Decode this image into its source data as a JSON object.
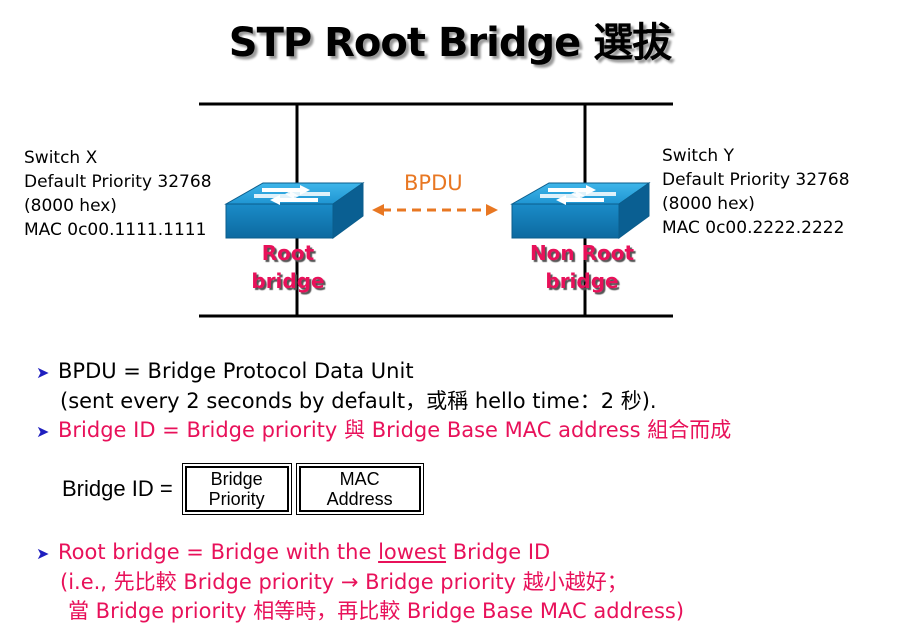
{
  "title": "STP Root Bridge 選拔",
  "switch_x": {
    "name": "Switch X",
    "priority": "Default Priority 32768",
    "hex": "(8000 hex)",
    "mac": "MAC 0c00.1111.1111",
    "role_line1": "Root",
    "role_line2": "bridge"
  },
  "switch_y": {
    "name": "Switch Y",
    "priority": "Default Priority 32768",
    "hex": "(8000 hex)",
    "mac": "MAC 0c00.2222.2222",
    "role_line1": "Non Root",
    "role_line2": "bridge"
  },
  "bpdu_label": "BPDU",
  "bullets": {
    "b1_line1": "BPDU = Bridge Protocol Data Unit",
    "b1_line2": "(sent every 2 seconds by default，或稱 hello time：2 秒).",
    "b2_line1": "Bridge ID = Bridge priority 與 Bridge Base MAC address 組合而成",
    "b3_line1": "Root bridge = Bridge with the ",
    "b3_line1_u": "lowest",
    "b3_line1_end": " Bridge ID",
    "b3_line2": "(i.e., 先比較 Bridge priority → Bridge priority 越小越好；",
    "b3_line3": "當 Bridge priority 相等時，再比較 Bridge Base MAC address)"
  },
  "formula": {
    "label": "Bridge ID =",
    "box1_l1": "Bridge",
    "box1_l2": "Priority",
    "box2_l1": "MAC",
    "box2_l2": "Address"
  },
  "colors": {
    "accent_pink": "#e8115a",
    "bpdu_orange": "#e87722",
    "switch_blue": "#1a9ad6",
    "bullet_arrow": "#1f1fbf"
  }
}
